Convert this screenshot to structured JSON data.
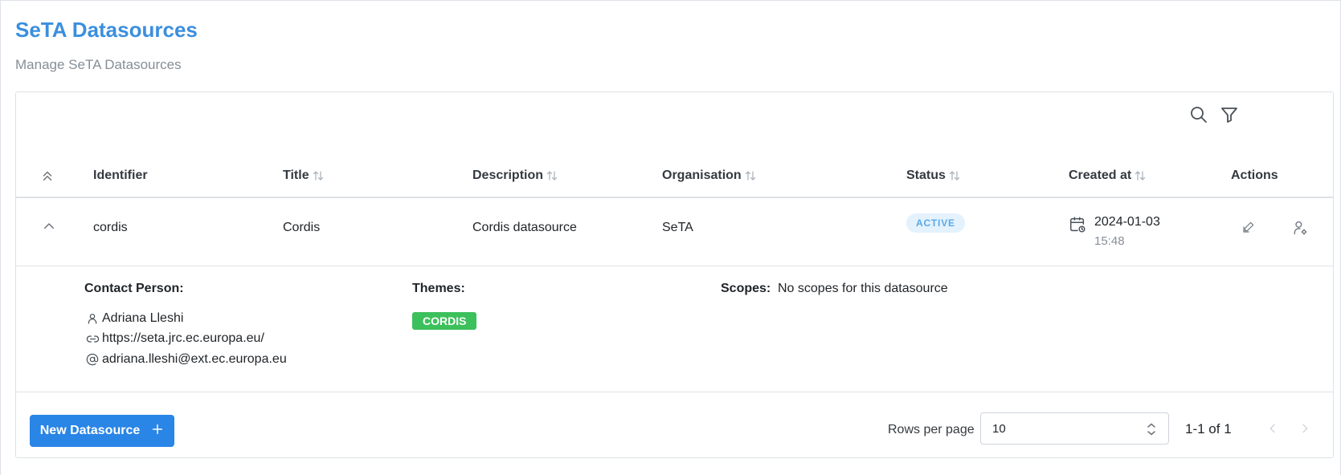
{
  "header": {
    "title": "SeTA Datasources",
    "subtitle": "Manage SeTA Datasources"
  },
  "toolbar": {
    "icons": [
      "search-icon",
      "filter-icon"
    ]
  },
  "table": {
    "columns": [
      {
        "label": "Identifier",
        "sortable": false
      },
      {
        "label": "Title",
        "sortable": true
      },
      {
        "label": "Description",
        "sortable": true
      },
      {
        "label": "Organisation",
        "sortable": true
      },
      {
        "label": "Status",
        "sortable": true
      },
      {
        "label": "Created at",
        "sortable": true
      },
      {
        "label": "Actions",
        "sortable": false
      }
    ],
    "rows": [
      {
        "identifier": "cordis",
        "title": "Cordis",
        "description": "Cordis datasource",
        "organisation": "SeTA",
        "status": "ACTIVE",
        "created_date": "2024-01-03",
        "created_time": "15:48",
        "expanded": true,
        "details": {
          "contact_label": "Contact Person:",
          "contact_name": "Adriana Lleshi",
          "contact_website": "https://seta.jrc.ec.europa.eu/",
          "contact_email": "adriana.lleshi@ext.ec.europa.eu",
          "themes_label": "Themes:",
          "themes": [
            "CORDIS"
          ],
          "scopes_label": "Scopes:",
          "scopes_empty": "No scopes for this datasource"
        }
      }
    ]
  },
  "footer": {
    "new_button_label": "New Datasource",
    "rows_per_page_label": "Rows per page",
    "rows_per_page_value": "10",
    "range_text": "1-1 of 1"
  },
  "colors": {
    "title": "#3b8fde",
    "primary_button": "#2985e6",
    "status_active_bg": "#e3f2fd",
    "status_active_text": "#5aa9e6",
    "theme_tag": "#3cc05b"
  }
}
